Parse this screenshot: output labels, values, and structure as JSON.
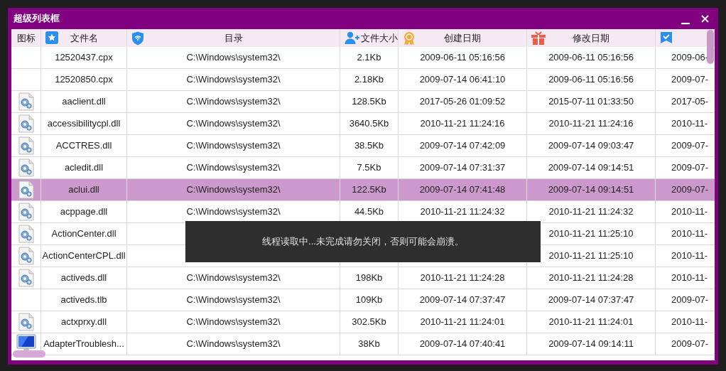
{
  "window": {
    "title": "超级列表框"
  },
  "table": {
    "columns": [
      "图标",
      "文件名",
      "目录",
      "文件大小",
      "创建日期",
      "修改日期"
    ],
    "rows": [
      {
        "kind": "plain",
        "name": "12520437.cpx",
        "directory": "C:\\Windows\\system32\\",
        "size": "2.1Kb",
        "created": "2009-06-11 05:16:56",
        "modified": "2009-06-11 05:16:56",
        "column_7": "2009-06-",
        "selected": false
      },
      {
        "kind": "plain",
        "name": "12520850.cpx",
        "directory": "C:\\Windows\\system32\\",
        "size": "2.18Kb",
        "created": "2009-07-14 06:41:10",
        "modified": "2009-06-11 05:16:56",
        "column_7": "2009-07-",
        "selected": false
      },
      {
        "kind": "settings-file",
        "name": "aaclient.dll",
        "directory": "C:\\Windows\\system32\\",
        "size": "128.5Kb",
        "created": "2017-05-26 01:09:52",
        "modified": "2015-07-11 01:33:50",
        "column_7": "2017-05-",
        "selected": false
      },
      {
        "kind": "settings-file",
        "name": "accessibilitycpl.dll",
        "directory": "C:\\Windows\\system32\\",
        "size": "3640.5Kb",
        "created": "2010-11-21 11:24:16",
        "modified": "2010-11-21 11:24:16",
        "column_7": "2010-11-",
        "selected": false
      },
      {
        "kind": "settings-file",
        "name": "ACCTRES.dll",
        "directory": "C:\\Windows\\system32\\",
        "size": "38.5Kb",
        "created": "2009-07-14 07:42:09",
        "modified": "2009-07-14 09:03:47",
        "column_7": "2009-07-",
        "selected": false
      },
      {
        "kind": "settings-file",
        "name": "acledit.dll",
        "directory": "C:\\Windows\\system32\\",
        "size": "7.5Kb",
        "created": "2009-07-14 07:31:37",
        "modified": "2009-07-14 09:14:51",
        "column_7": "2009-07-",
        "selected": false
      },
      {
        "kind": "settings-file",
        "name": "aclui.dll",
        "directory": "C:\\Windows\\system32\\",
        "size": "122.5Kb",
        "created": "2009-07-14 07:41:48",
        "modified": "2009-07-14 09:14:51",
        "column_7": "2009-07-",
        "selected": true
      },
      {
        "kind": "settings-file",
        "name": "acppage.dll",
        "directory": "C:\\Windows\\system32\\",
        "size": "44.5Kb",
        "created": "2010-11-21 11:24:32",
        "modified": "2010-11-21 11:24:32",
        "column_7": "2010-11-",
        "selected": false
      },
      {
        "kind": "settings-file",
        "name": "ActionCenter.dll",
        "modified": "2010-11-21 11:25:10",
        "column_7": "2010-11-",
        "selected": false
      },
      {
        "kind": "settings-file",
        "name": "ActionCenterCPL.dll",
        "modified": "2010-11-21 11:25:10",
        "column_7": "2010-11-",
        "selected": false
      },
      {
        "kind": "settings-file",
        "name": "activeds.dll",
        "directory": "C:\\Windows\\system32\\",
        "size": "198Kb",
        "created": "2010-11-21 11:24:28",
        "modified": "2010-11-21 11:24:28",
        "column_7": "2010-11-",
        "selected": false
      },
      {
        "kind": "plain",
        "name": "activeds.tlb",
        "directory": "C:\\Windows\\system32\\",
        "size": "109Kb",
        "created": "2009-07-14 07:37:47",
        "modified": "2009-07-14 07:37:47",
        "column_7": "2009-07-",
        "selected": false
      },
      {
        "kind": "settings-file",
        "name": "actxprxy.dll",
        "directory": "C:\\Windows\\system32\\",
        "size": "302.5Kb",
        "created": "2010-11-21 11:24:01",
        "modified": "2010-11-21 11:24:01",
        "column_7": "2010-11-",
        "selected": false
      },
      {
        "kind": "display",
        "name": "AdapterTroublesh...",
        "directory": "C:\\Windows\\system32\\",
        "size": "38Kb",
        "created": "2009-07-14 07:40:41",
        "modified": "2009-07-14 09:14:11",
        "column_7": "2009-07-",
        "selected": false
      }
    ]
  },
  "overlay": {
    "message": "线程读取中...未完成请勿关闭，否则可能会崩溃。"
  }
}
